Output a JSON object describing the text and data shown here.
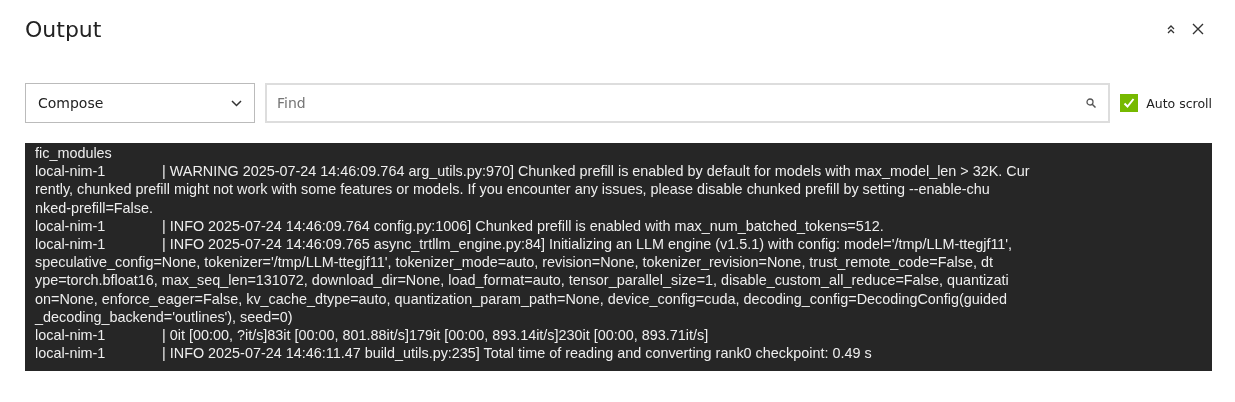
{
  "title": "Output",
  "source_select": {
    "value": "Compose"
  },
  "search": {
    "placeholder": "Find"
  },
  "auto_scroll": {
    "label": "Auto scroll",
    "checked": true
  },
  "log_lines": [
    {
      "text": "fic_modules"
    },
    {
      "source": "local-nim-1",
      "text": "| WARNING 2025-07-24 14:46:09.764 arg_utils.py:970] Chunked prefill is enabled by default for models with max_model_len > 32K. Cur"
    },
    {
      "text": "rently, chunked prefill might not work with some features or models. If you encounter any issues, please disable chunked prefill by setting --enable-chu"
    },
    {
      "text": "nked-prefill=False."
    },
    {
      "source": "local-nim-1",
      "text": "| INFO 2025-07-24 14:46:09.764 config.py:1006] Chunked prefill is enabled with max_num_batched_tokens=512."
    },
    {
      "source": "local-nim-1",
      "text": "| INFO 2025-07-24 14:46:09.765 async_trtllm_engine.py:84] Initializing an LLM engine (v1.5.1) with config: model='/tmp/LLM-ttegjf11',"
    },
    {
      "text": "speculative_config=None, tokenizer='/tmp/LLM-ttegjf11', tokenizer_mode=auto, revision=None, tokenizer_revision=None, trust_remote_code=False, dt"
    },
    {
      "text": "ype=torch.bfloat16, max_seq_len=131072, download_dir=None, load_format=auto, tensor_parallel_size=1, disable_custom_all_reduce=False, quantizati"
    },
    {
      "text": "on=None, enforce_eager=False, kv_cache_dtype=auto, quantization_param_path=None, device_config=cuda, decoding_config=DecodingConfig(guided"
    },
    {
      "text": "_decoding_backend='outlines'), seed=0)"
    },
    {
      "source": "local-nim-1",
      "text": "| 0it [00:00, ?it/s]83it [00:00, 801.88it/s]179it [00:00, 893.14it/s]230it [00:00, 893.71it/s]"
    },
    {
      "source": "local-nim-1",
      "text": "| INFO 2025-07-24 14:46:11.47 build_utils.py:235] Total time of reading and converting rank0 checkpoint: 0.49 s"
    }
  ]
}
